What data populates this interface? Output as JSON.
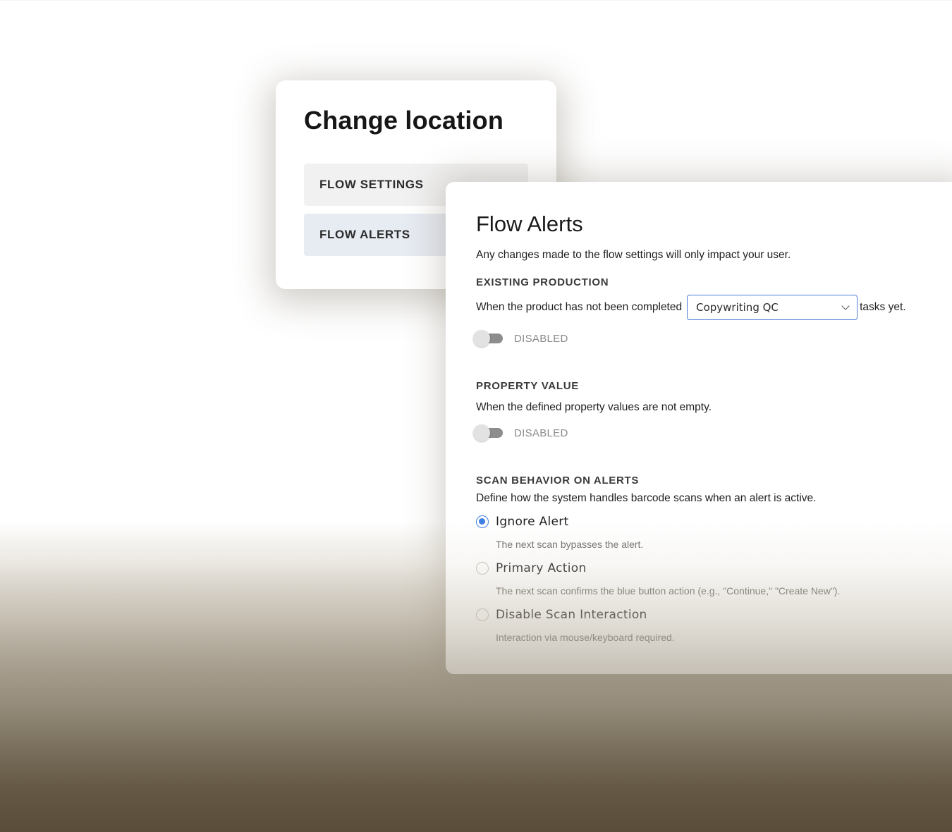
{
  "location_card": {
    "title": "Change location",
    "menu": [
      {
        "label": "FLOW SETTINGS"
      },
      {
        "label": "FLOW ALERTS"
      }
    ]
  },
  "alerts_card": {
    "title": "Flow Alerts",
    "description": "Any changes made to the flow settings will only impact your user.",
    "existing_production": {
      "heading": "EXISTING PRODUCTION",
      "text_before": "When the product has not been completed",
      "select_value": "Copywriting QC",
      "text_after": "tasks yet.",
      "toggle_label": "DISABLED"
    },
    "property_value": {
      "heading": "PROPERTY VALUE",
      "text": "When the defined property values are not empty.",
      "toggle_label": "DISABLED"
    },
    "scan_behavior": {
      "heading": "SCAN BEHAVIOR ON ALERTS",
      "description": "Define how the system handles barcode scans when an alert is active.",
      "selected": "Ignore Alert",
      "options": [
        {
          "label": "Ignore Alert",
          "hint": "The next scan bypasses the alert."
        },
        {
          "label": "Primary Action",
          "hint": "The next scan confirms the blue button action (e.g., \"Continue,\" \"Create New\")."
        },
        {
          "label": "Disable Scan Interaction",
          "hint": "Interaction via mouse/keyboard required."
        }
      ]
    }
  },
  "colors": {
    "accent": "#3f7fe3",
    "toggle_track": "#8d8d8d",
    "active_menu_bg": "#e7ebf2"
  }
}
